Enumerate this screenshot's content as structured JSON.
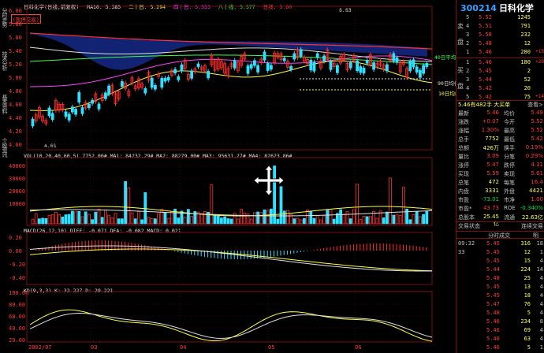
{
  "window": {
    "title": "日科化学(日线,前复权)"
  },
  "left_tabs": [
    "分时走势",
    "技术分析",
    "基本资料",
    "个股资讯"
  ],
  "main_chart": {
    "legend": {
      "title": "日科化学(日线,前复权)",
      "ma5": "MA10: 5.385",
      "ma20": "二十日: 5.294",
      "ma40": "四十日: 5.553",
      "ma80": "八十线: 5.577",
      "ma120": "日线: 5.60"
    },
    "price_labels": [
      "6.00",
      "5.80",
      "5.60",
      "5.40",
      "5.20",
      "5.00",
      "4.80",
      "4.60",
      "4.40",
      "4.20",
      "4.00"
    ],
    "high_marker": "6.63",
    "low_marker": "4.01",
    "tag_label": "(暂停交易)",
    "right_labels": {
      "line40": "40日平均",
      "line90": "90日均价",
      "line10": "10日均线",
      "price1": "+15",
      "price2": "+14",
      "price3": "+13"
    }
  },
  "volume_chart": {
    "legend": "VOL(10,20,40,60,5)  7752.00#  MA1: 84232.29#  MA2: 88279.00#  MA3: 95631.27#  MA4: 82623.86#",
    "labels": [
      "40000",
      "30000",
      "20000",
      "10000"
    ]
  },
  "macd_chart": {
    "legend": "MACD(26,12,10)  DIFF: -0.071  DEA: -0.082  MACD: 0.021",
    "labels": [
      "0.20",
      "0.00",
      "-0.20",
      "-0.40"
    ]
  },
  "kd_chart": {
    "legend": "KD(9,3,3)  K: 32.227  D: 29.221",
    "labels": [
      "100.00",
      "80.00",
      "60.00",
      "40.00",
      "20.00"
    ]
  },
  "x_axis": [
    "2002/07",
    "03",
    "04",
    "05",
    "06"
  ],
  "chart_data": [
    {
      "type": "line",
      "title": "日科化学(日线,前复权)",
      "x": [
        "2002/07",
        "03",
        "04",
        "05",
        "06"
      ],
      "series": [
        {
          "name": "二十日",
          "values": [
            4.5,
            5.1,
            5.4,
            5.5,
            5.3
          ]
        },
        {
          "name": "四十日",
          "values": [
            5.2,
            5.0,
            5.2,
            5.5,
            5.55
          ]
        },
        {
          "name": "八十线",
          "values": [
            5.9,
            5.7,
            5.65,
            5.6,
            5.58
          ]
        }
      ],
      "ylim": [
        4.0,
        6.0
      ]
    }
  ],
  "quote": {
    "code": "300214",
    "name": "日科化学",
    "sell_label": "卖",
    "buy_label": "买",
    "sell_side_label": "盘",
    "buy_side_label": "盘",
    "asks": [
      {
        "level": "5",
        "price": "5.52",
        "vol": "1245",
        "chg": ""
      },
      {
        "level": "4",
        "price": "5.51",
        "vol": "791",
        "chg": ""
      },
      {
        "level": "3",
        "price": "5.50",
        "vol": "232",
        "chg": ""
      },
      {
        "level": "2",
        "price": "5.48",
        "vol": "12",
        "chg": ""
      },
      {
        "level": "1",
        "price": "5.46",
        "vol": "280",
        "chg": "+15"
      }
    ],
    "bids": [
      {
        "level": "1",
        "price": "5.46",
        "vol": "180",
        "chg": "+20"
      },
      {
        "level": "2",
        "price": "5.45",
        "vol": "2",
        "chg": ""
      },
      {
        "level": "3",
        "price": "5.44",
        "vol": "52",
        "chg": ""
      },
      {
        "level": "4",
        "price": "5.42",
        "vol": "20",
        "chg": ""
      },
      {
        "level": "5",
        "price": "5.42",
        "vol": "75",
        "chg": "+14"
      }
    ],
    "summary_line": "5.46有482手 大买单",
    "summary_right": "查看>",
    "stats": [
      {
        "k1": "最新",
        "v1": "5.46",
        "k2": "均价",
        "v2": "5.49"
      },
      {
        "k1": "涨跌",
        "v1": "+0.07",
        "k2": "今开",
        "v2": "5.52"
      },
      {
        "k1": "涨幅",
        "v1": "1.30%",
        "k2": "最高",
        "v2": "5.52"
      },
      {
        "k1": "总手",
        "v1": "7752",
        "k2": "最低",
        "v2": "5.42"
      },
      {
        "k1": "总额",
        "v1": "426万",
        "k2": "换手",
        "v2": "0.19%"
      },
      {
        "k1": "量比",
        "v1": "3.09",
        "k2": "分笔",
        "v2": "0.29%"
      },
      {
        "k1": "涨停",
        "v1": "5.47",
        "k2": "跌停",
        "v2": "4.31"
      },
      {
        "k1": "买现",
        "v1": "5.59",
        "k2": "卖现",
        "v2": "5.61"
      },
      {
        "k1": "总笔",
        "v1": "472",
        "k2": "每笔",
        "v2": "16.4"
      },
      {
        "k1": "内盘",
        "v1": "3331",
        "k2": "外盘",
        "v2": "4421"
      },
      {
        "k1": "市盈",
        "v1": "-73.01",
        "k2": "市净",
        "v2": "1.00"
      },
      {
        "k1": "市盈*",
        "v1": "43.73",
        "k2": "ROE",
        "v2": "-0.340%"
      },
      {
        "k1": "总股本",
        "v1": "25.45亿",
        "k2": "流通",
        "v2": "22.63亿"
      }
    ],
    "trade_tabs": [
      "交易状态",
      "连续交易"
    ],
    "ticks_header": [
      "分时成交",
      "",
      "明"
    ],
    "ticks": [
      {
        "t": "09:32",
        "p": "5.45",
        "v": "316",
        "n": "18"
      },
      {
        "t": "33",
        "p": "5.45",
        "v": "12",
        "n": "1"
      },
      {
        "t": "",
        "p": "5.45",
        "v": "15",
        "n": "4"
      },
      {
        "t": "",
        "p": "5.44",
        "v": "224",
        "n": "14"
      },
      {
        "t": "",
        "p": "5.48",
        "v": "25",
        "n": "4"
      },
      {
        "t": "",
        "p": "5.45",
        "v": "13",
        "n": "4"
      },
      {
        "t": "",
        "p": "5.45",
        "v": "18",
        "n": "4"
      },
      {
        "t": "",
        "p": "5.47",
        "v": "76",
        "n": "4"
      },
      {
        "t": "",
        "p": "5.48",
        "v": "5",
        "n": "4"
      },
      {
        "t": "",
        "p": "5.46",
        "v": "234",
        "n": "8"
      },
      {
        "t": "",
        "p": "5.46",
        "v": "69",
        "n": "4"
      },
      {
        "t": "",
        "p": "5.46",
        "v": "63",
        "n": "4"
      },
      {
        "t": "",
        "p": "5.46",
        "v": "5",
        "n": "1"
      }
    ]
  },
  "bottom_tabs": [
    "日线",
    "周线",
    "月线",
    "分钟",
    "技术指标",
    "自选"
  ]
}
